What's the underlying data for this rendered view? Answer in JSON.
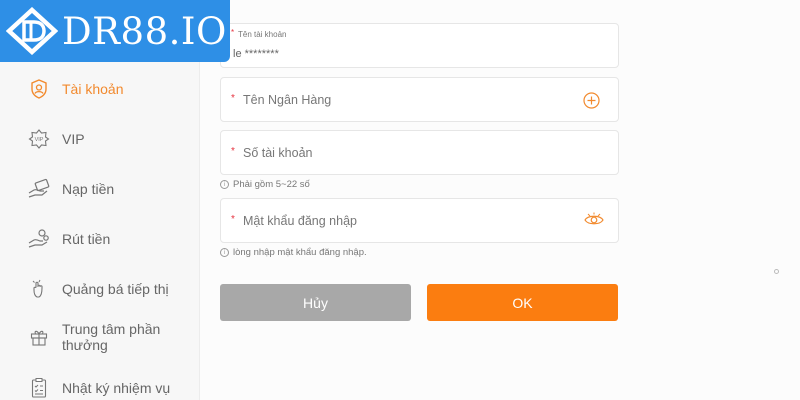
{
  "logo": {
    "text": "DR88.IO"
  },
  "sidebar": {
    "items": [
      {
        "label": "Tài khoản",
        "icon": "user-shield-icon",
        "active": true
      },
      {
        "label": "VIP",
        "icon": "vip-badge-icon",
        "active": false
      },
      {
        "label": "Nạp tiền",
        "icon": "deposit-hand-icon",
        "active": false
      },
      {
        "label": "Rút tiền",
        "icon": "withdraw-hand-icon",
        "active": false
      },
      {
        "label": "Quảng bá tiếp thị",
        "icon": "promotion-icon",
        "active": false
      },
      {
        "label": "Trung tâm phần thưởng",
        "icon": "gift-icon",
        "active": false
      },
      {
        "label": "Nhật ký nhiệm vụ",
        "icon": "task-log-icon",
        "active": false
      }
    ]
  },
  "form": {
    "account_name": {
      "label": "Tên tài khoản",
      "value": "le ********"
    },
    "bank_name": {
      "placeholder": "Tên Ngân Hàng"
    },
    "account_number": {
      "placeholder": "Số tài khoản",
      "hint": "Phải gồm 5~22 số"
    },
    "password": {
      "placeholder": "Mật khẩu đăng nhập",
      "hint": "lòng nhập mật khẩu đăng nhập."
    },
    "required_mark": "*",
    "hint_icon": "i"
  },
  "buttons": {
    "cancel": "Hủy",
    "ok": "OK"
  },
  "colors": {
    "brand": "#2e8fe6",
    "accent": "#fb7d10",
    "active": "#f28a2e",
    "cancel": "#a8a8a8",
    "required": "#e6333f"
  }
}
